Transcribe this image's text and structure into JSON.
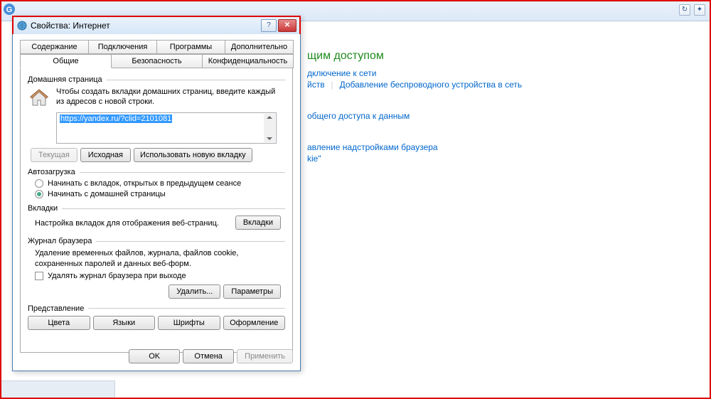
{
  "topbar": {
    "logo_letter": "G"
  },
  "dialog": {
    "title": "Свойства: Интернет",
    "tabs_row1": [
      "Содержание",
      "Подключения",
      "Программы",
      "Дополнительно"
    ],
    "tabs_row2": [
      "Общие",
      "Безопасность",
      "Конфиденциальность"
    ],
    "active_tab": "Общие",
    "home": {
      "group_label": "Домашняя страница",
      "desc": "Чтобы создать вкладки домашних страниц, введите каждый из адресов с новой строки.",
      "url": "https://yandex.ru/?clid=2101081",
      "btn_current": "Текущая",
      "btn_default": "Исходная",
      "btn_newtab": "Использовать новую вкладку"
    },
    "startup": {
      "group_label": "Автозагрузка",
      "opt_last": "Начинать с вкладок, открытых в предыдущем сеансе",
      "opt_home": "Начинать с домашней страницы"
    },
    "tabs_group": {
      "group_label": "Вкладки",
      "desc": "Настройка вкладок для отображения веб-страниц.",
      "btn": "Вкладки"
    },
    "history": {
      "group_label": "Журнал браузера",
      "desc": "Удаление временных файлов, журнала, файлов cookie, сохраненных паролей и данных веб-форм.",
      "chk_label": "Удалять журнал браузера при выходе",
      "btn_delete": "Удалить...",
      "btn_settings": "Параметры"
    },
    "appearance": {
      "group_label": "Представление",
      "btn_colors": "Цвета",
      "btn_langs": "Языки",
      "btn_fonts": "Шрифты",
      "btn_access": "Оформление"
    },
    "footer": {
      "ok": "OK",
      "cancel": "Отмена",
      "apply": "Применить"
    }
  },
  "bg": {
    "heading": "щим доступом",
    "link1a": "дключение к сети",
    "link1b": "йств",
    "link1c": "Добавление беспроводного устройства в сеть",
    "link2": "общего доступа к данным",
    "link3": "авление надстройками браузера",
    "link4": "kie\""
  }
}
